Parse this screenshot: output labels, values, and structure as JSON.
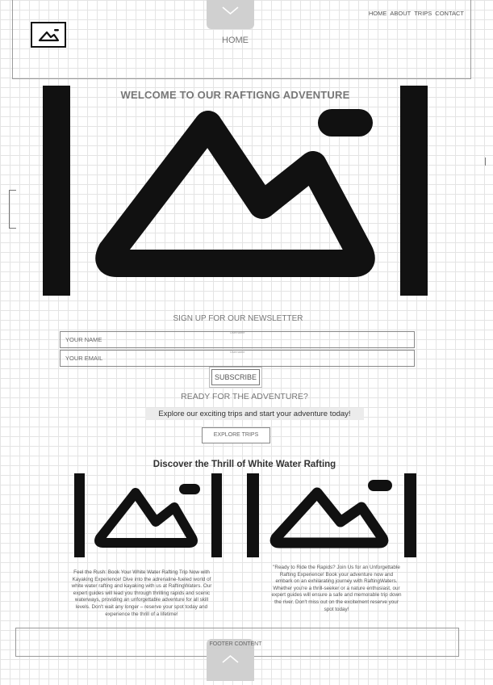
{
  "header": {
    "title": "HOME",
    "nav": [
      "HOME",
      "ABOUT",
      "TRIPS",
      "CONTACT"
    ]
  },
  "hero": {
    "title": "WELCOME TO OUR RAFTIGNG  ADVENTURE",
    "image_icon": "image-placeholder-icon"
  },
  "newsletter": {
    "title": "SIGN UP FOR OUR NEWSLETTER",
    "name_placeholder": "YOUR NAME",
    "email_placeholder": "YOUR EMAIL",
    "mini_label": "Username",
    "subscribe_label": "SUBSCRIBE"
  },
  "cta": {
    "title": "READY FOR THE ADVENTURE?",
    "text": "Explore our exciting trips and start your adventure today!",
    "button_label": "EXPLORE TRIPS"
  },
  "discover": {
    "title": "Discover the Thrill of White Water Rafting",
    "cards": [
      {
        "text": "Feel the Rush: Book Your White Water Rafting Trip Now with Kayaking Experience! Dive into the adrenaline-fueled world of white water rafting and kayaking with us at RaftingWaters. Our expert guides will lead you through thrilling rapids and scenic waterways, providing an unforgettable adventure for all skill levels. Don't wait any longer – reserve your spot today and experience the thrill of a lifetime!"
      },
      {
        "text": "\"Ready to Ride the Rapids? Join Us for an Unforgettable Rafting Experience! Book your adventure now and embark on an exhilarating journey with RaftingWaters. Whether you're a thrill-seeker or a nature enthusiast, our expert guides will ensure a safe and memorable trip down the river. Don't miss out on the excitement reserve your spot today!"
      }
    ]
  },
  "footer": {
    "text": "FOOTER CONTENT"
  },
  "icons": {
    "top_tab": "chevron-down-icon",
    "bottom_tab": "chevron-up-icon"
  }
}
